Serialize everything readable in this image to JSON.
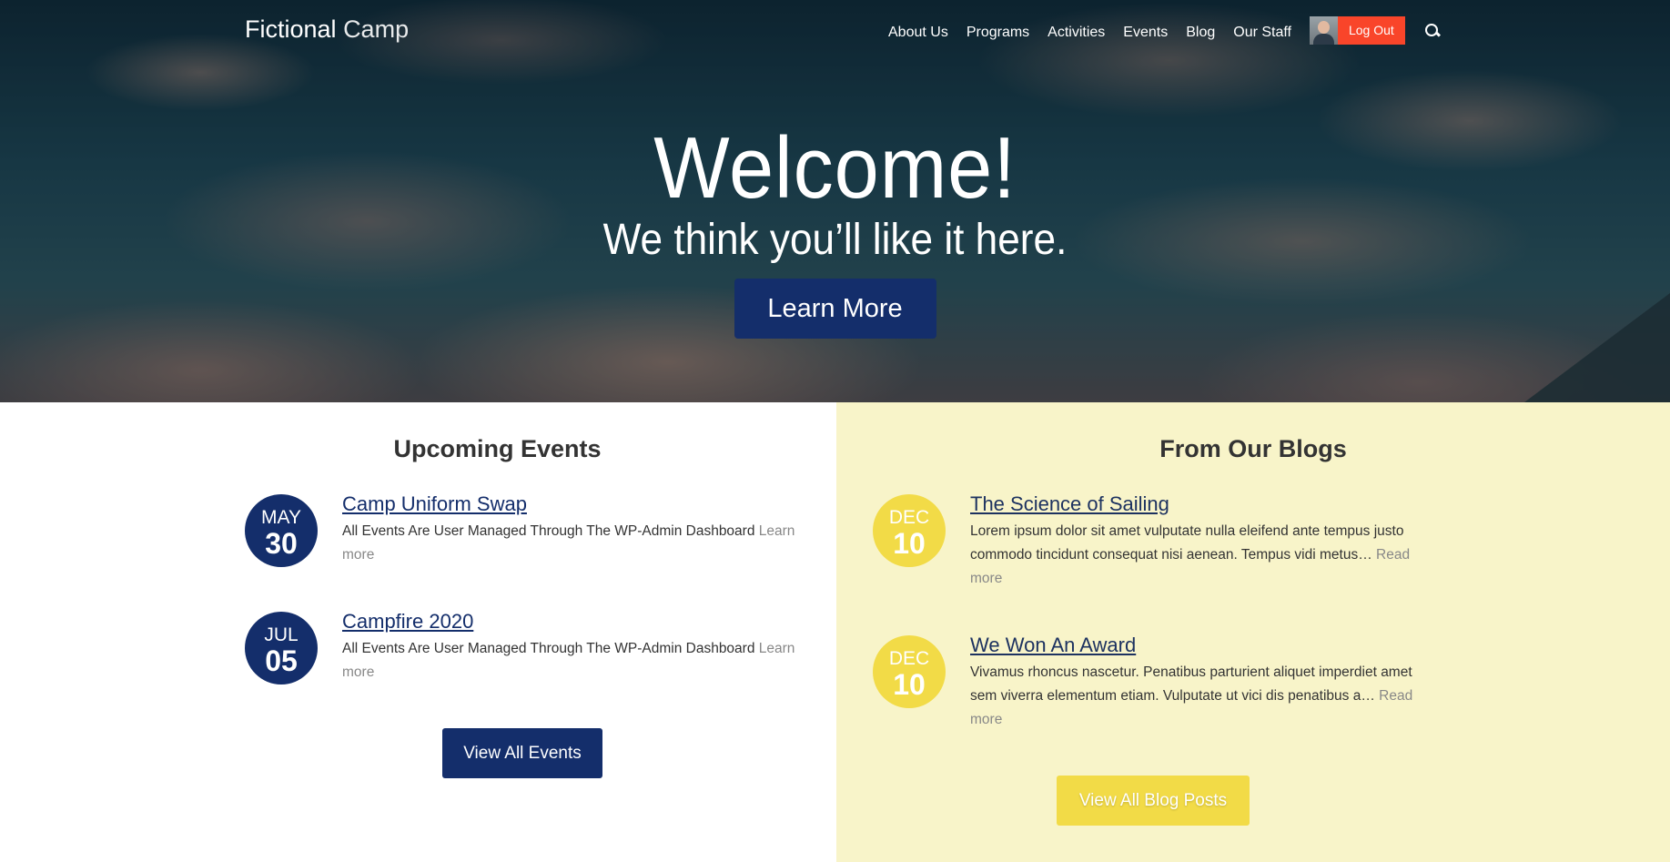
{
  "header": {
    "logo_bold": "Fictional",
    "logo_light": "Camp",
    "nav": [
      "About Us",
      "Programs",
      "Activities",
      "Events",
      "Blog",
      "Our Staff"
    ],
    "logout_label": "Log Out"
  },
  "hero": {
    "title": "Welcome!",
    "subtitle": "We think you’ll like it here.",
    "button": "Learn More"
  },
  "events": {
    "title": "Upcoming Events",
    "items": [
      {
        "month": "MAY",
        "day": "30",
        "title": "Camp Uniform Swap",
        "body": "All Events Are User Managed Through The WP-Admin Dashboard",
        "more": "Learn more"
      },
      {
        "month": "JUL",
        "day": "05",
        "title": "Campfire 2020",
        "body": "All Events Are User Managed Through The WP-Admin Dashboard",
        "more": "Learn more"
      }
    ],
    "button": "View All Events"
  },
  "blogs": {
    "title": "From Our Blogs",
    "items": [
      {
        "month": "DEC",
        "day": "10",
        "title": "The Science of Sailing",
        "body": "Lorem ipsum dolor sit amet vulputate nulla eleifend ante tempus justo commodo tincidunt consequat nisi aenean. Tempus vidi metus…",
        "more": "Read more"
      },
      {
        "month": "DEC",
        "day": "10",
        "title": "We Won An Award",
        "body": "Vivamus rhoncus nascetur. Penatibus parturient aliquet imperdiet amet sem viverra elementum etiam. Vulputate ut vici dis penatibus a…",
        "more": "Read more"
      }
    ],
    "button": "View All Blog Posts"
  },
  "colors": {
    "navy": "#142e6b",
    "yellow": "#f2db47",
    "cream": "#f8f4c9",
    "logout": "#f9452a"
  }
}
